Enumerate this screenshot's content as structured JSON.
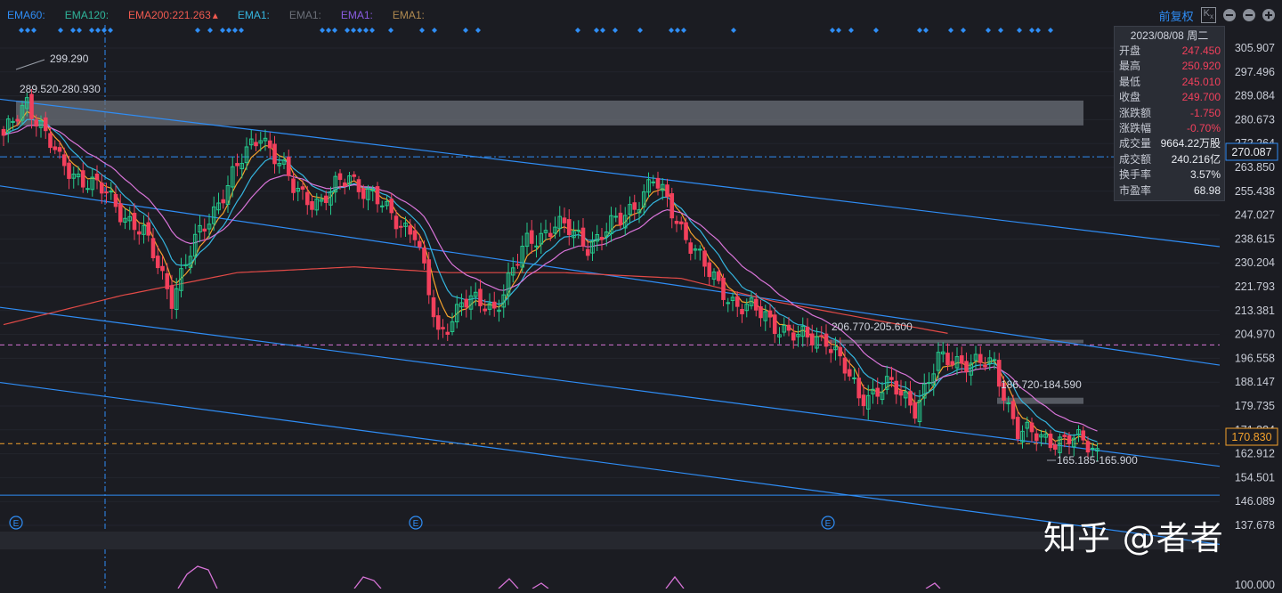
{
  "ema_legend": [
    {
      "label": "EMA60:",
      "color": "#2f8df5"
    },
    {
      "label": "EMA120:",
      "color": "#2fb59a"
    },
    {
      "label": "EMA200:221.263",
      "color": "#f05a50"
    },
    {
      "label": "EMA1:",
      "color": "#35b6e0"
    },
    {
      "label": "EMA1:",
      "color": "#6b6f78"
    },
    {
      "label": "EMA1:",
      "color": "#8a5ce0"
    },
    {
      "label": "EMA1:",
      "color": "#b08a50"
    }
  ],
  "ema200_arrow": "▴",
  "toolbar": {
    "adjust_label": "前复权",
    "chart_type_icon": "kx-icon",
    "minimize_icon": "minus-circle-icon",
    "zoom_out_icon": "minus-circle-icon",
    "zoom_in_icon": "plus-circle-icon"
  },
  "info_box": {
    "date": "2023/08/08 周二",
    "rows": [
      {
        "label": "开盘",
        "value": "247.450",
        "color": "red"
      },
      {
        "label": "最高",
        "value": "250.920",
        "color": "red"
      },
      {
        "label": "最低",
        "value": "245.010",
        "color": "red"
      },
      {
        "label": "收盘",
        "value": "249.700",
        "color": "red"
      },
      {
        "label": "涨跌额",
        "value": "-1.750",
        "color": "red"
      },
      {
        "label": "涨跌幅",
        "value": "-0.70%",
        "color": "red"
      },
      {
        "label": "成交量",
        "value": "9664.22万股",
        "color": "white"
      },
      {
        "label": "成交额",
        "value": "240.216亿",
        "color": "white"
      },
      {
        "label": "换手率",
        "value": "3.57%",
        "color": "white"
      },
      {
        "label": "市盈率",
        "value": "68.98",
        "color": "white"
      }
    ]
  },
  "watermark": "知乎 @者者",
  "event_marker": "E",
  "colors": {
    "up": "#24c98c",
    "down": "#f2405c",
    "channel": "#2f8df5",
    "ema_orange": "#f5a22c",
    "ema_cyan": "#35b6e0",
    "ema_pink": "#d874d8",
    "ema200": "#e24a47",
    "crosshair": "#2f8df5",
    "signal_dot": "#2f8df5"
  },
  "chart_data": {
    "type": "candlestick",
    "y_axis": {
      "range": [
        139.5,
        312
      ],
      "tick_labels": [
        "305.907",
        "297.496",
        "289.084",
        "280.673",
        "272.264",
        "263.850",
        "255.438",
        "247.027",
        "238.615",
        "230.204",
        "221.793",
        "213.381",
        "204.970",
        "196.558",
        "188.147",
        "179.735",
        "171.324",
        "162.912",
        "154.501",
        "146.089",
        "137.678"
      ],
      "oscillator_tick": "100.000"
    },
    "price_tags": [
      {
        "value": "270.087",
        "style": "crosshair"
      },
      {
        "value": "170.830",
        "style": "current"
      }
    ],
    "horizontal_levels": [
      {
        "value": 270.087,
        "style": "dash-dot",
        "color": "#2f8df5"
      },
      {
        "value": 205.0,
        "style": "dashed",
        "color": "#d874d8"
      },
      {
        "value": 170.83,
        "style": "dashed",
        "color": "#f5a22c"
      },
      {
        "value": 153.0,
        "style": "solid",
        "color": "#2f8df5"
      }
    ],
    "zones": [
      {
        "label": "289.520-280.930",
        "low": 280.93,
        "high": 289.52
      },
      {
        "label": "206.770-205.600",
        "low": 205.6,
        "high": 206.77
      },
      {
        "label": "186.720-184.590",
        "low": 184.59,
        "high": 186.72
      }
    ],
    "extreme_labels": [
      {
        "label": "299.290",
        "value": 299.29
      },
      {
        "label": "165.185-165.900",
        "value": 165.54
      }
    ],
    "channel_lines": [
      {
        "start": 290,
        "end": 239
      },
      {
        "start": 260,
        "end": 198
      },
      {
        "start": 218,
        "end": 163
      },
      {
        "start": 192,
        "end": 136
      }
    ],
    "anchors": [
      [
        0,
        276
      ],
      [
        5,
        290
      ],
      [
        12,
        268
      ],
      [
        22,
        257
      ],
      [
        30,
        243
      ],
      [
        36,
        222
      ],
      [
        41,
        240
      ],
      [
        47,
        258
      ],
      [
        55,
        279
      ],
      [
        62,
        259
      ],
      [
        68,
        254
      ],
      [
        74,
        264
      ],
      [
        82,
        251
      ],
      [
        88,
        244
      ],
      [
        93,
        208
      ],
      [
        98,
        220
      ],
      [
        105,
        218
      ],
      [
        112,
        240
      ],
      [
        118,
        247
      ],
      [
        125,
        240
      ],
      [
        132,
        248
      ],
      [
        139,
        262
      ],
      [
        145,
        246
      ],
      [
        151,
        229
      ],
      [
        157,
        219
      ],
      [
        163,
        215
      ],
      [
        170,
        207
      ],
      [
        176,
        208
      ],
      [
        183,
        187
      ],
      [
        189,
        191
      ],
      [
        195,
        184
      ],
      [
        200,
        199
      ],
      [
        206,
        200
      ],
      [
        212,
        197
      ],
      [
        217,
        176
      ],
      [
        222,
        172
      ],
      [
        228,
        173
      ],
      [
        234,
        168
      ]
    ],
    "ema200_anchors": [
      [
        0,
        212
      ],
      [
        25,
        222
      ],
      [
        50,
        230
      ],
      [
        75,
        232
      ],
      [
        95,
        230
      ],
      [
        120,
        230
      ],
      [
        145,
        228
      ],
      [
        165,
        220
      ],
      [
        185,
        214
      ],
      [
        202,
        209
      ]
    ]
  }
}
